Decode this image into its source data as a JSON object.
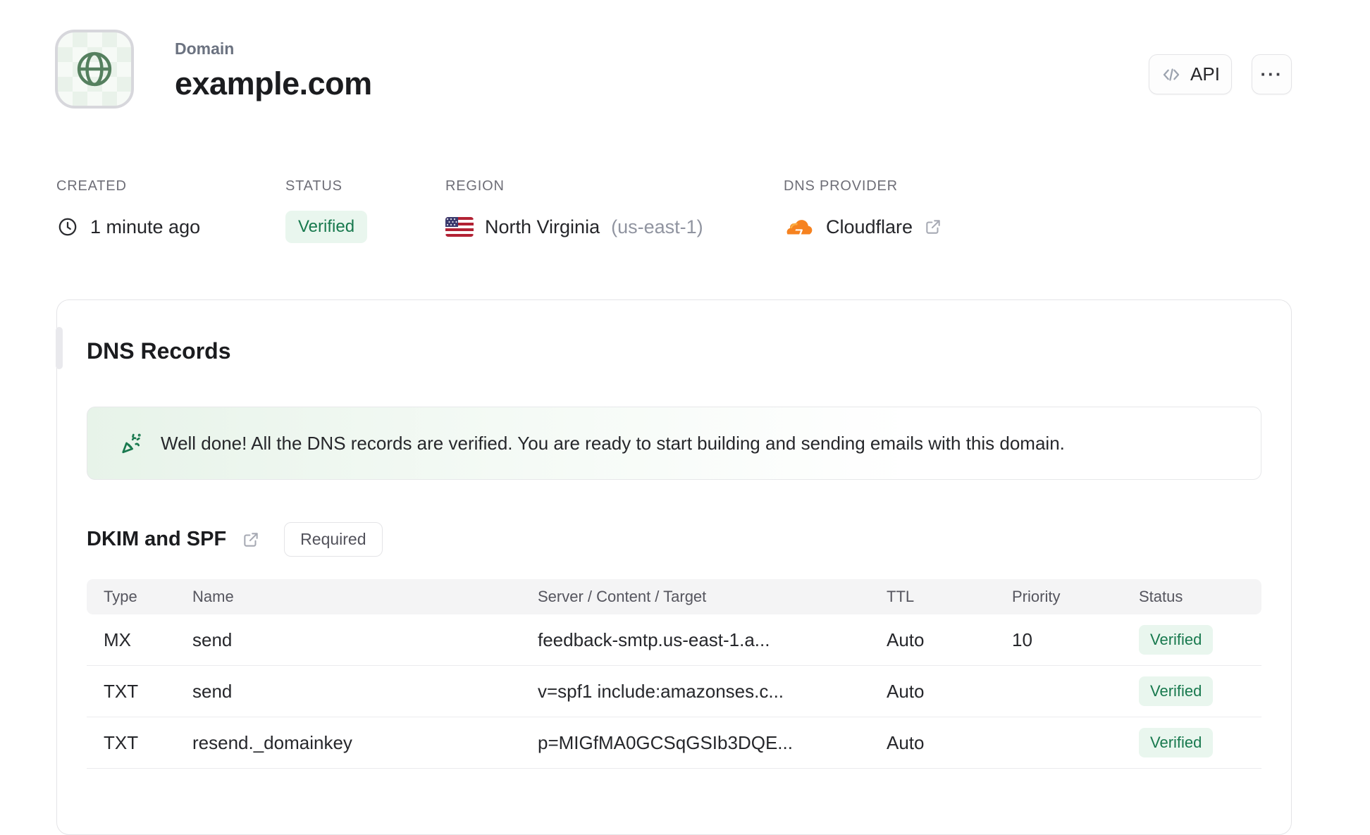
{
  "header": {
    "eyebrow": "Domain",
    "title": "example.com",
    "api_button_label": "API",
    "more_button_glyph": "···"
  },
  "meta": {
    "created": {
      "label": "CREATED",
      "value": "1 minute ago"
    },
    "status": {
      "label": "STATUS",
      "badge": "Verified"
    },
    "region": {
      "label": "REGION",
      "name": "North Virginia",
      "code": "(us-east-1)"
    },
    "dns_provider": {
      "label": "DNS PROVIDER",
      "name": "Cloudflare"
    }
  },
  "dns_card": {
    "title": "DNS Records",
    "banner_text": "Well done! All the DNS records are verified. You are ready to start building and sending emails with this domain.",
    "section": {
      "title": "DKIM and SPF",
      "badge": "Required"
    },
    "table": {
      "headers": [
        "Type",
        "Name",
        "Server / Content / Target",
        "TTL",
        "Priority",
        "Status"
      ],
      "rows": [
        {
          "type": "MX",
          "name": "send",
          "content": "feedback-smtp.us-east-1.a...",
          "ttl": "Auto",
          "priority": "10",
          "status": "Verified"
        },
        {
          "type": "TXT",
          "name": "send",
          "content": "v=spf1 include:amazonses.c...",
          "ttl": "Auto",
          "priority": "",
          "status": "Verified"
        },
        {
          "type": "TXT",
          "name": "resend._domainkey",
          "content": "p=MIGfMA0GCSqGSIb3DQE...",
          "ttl": "Auto",
          "priority": "",
          "status": "Verified"
        }
      ]
    }
  },
  "icons": {
    "globe": "globe outline",
    "code": "</>",
    "ellipsis": "···",
    "clock": "clock outline",
    "us_flag": "US flag",
    "cloudflare": "orange cloud",
    "external_link": "arrow out of box",
    "party_popper": "confetti cone"
  },
  "colors": {
    "verified_text": "#18794e",
    "verified_bg": "#e9f6ee",
    "cloudflare_orange": "#f6821f",
    "cloudflare_light": "#fbad41",
    "border": "#e4e4e7",
    "table_header_bg": "#f4f4f5",
    "text_dark": "#1b1c1f",
    "text_gray": "#6e6e77",
    "globe_green": "#55805f"
  }
}
